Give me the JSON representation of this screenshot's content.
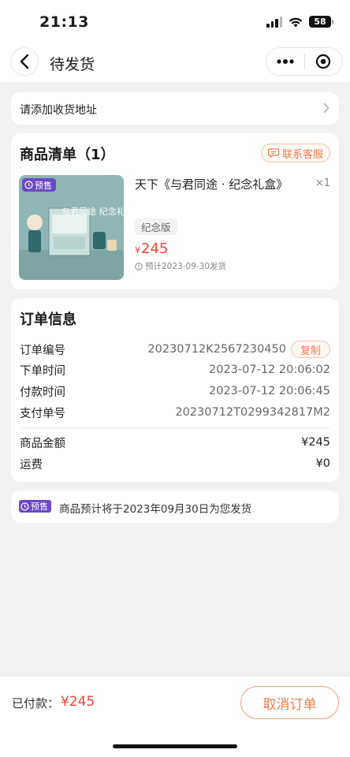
{
  "status_bar": {
    "time": "21:13",
    "battery": "58"
  },
  "nav": {
    "title": "待发货"
  },
  "address": {
    "placeholder_text": "请添加收货地址"
  },
  "goods": {
    "title": "商品清单（1）",
    "contact_label": "联系客服",
    "presale_badge": "预售",
    "product_name": "天下《与君同途 · 纪念礼盒》",
    "quantity": "×1",
    "variant": "纪念版",
    "price_symbol": "¥",
    "price": "245",
    "ship_estimate": "预计2023-09-30发货",
    "image_caption": "与君同途 纪念礼盒"
  },
  "order_info": {
    "title": "订单信息",
    "rows": [
      {
        "label": "订单编号",
        "value": "20230712K2567230450"
      },
      {
        "label": "下单时间",
        "value": "2023-07-12 20:06:02"
      },
      {
        "label": "付款时间",
        "value": "2023-07-12 20:06:45"
      },
      {
        "label": "支付单号",
        "value": "20230712T0299342817M2"
      }
    ],
    "copy_label": "复制",
    "amount_rows": [
      {
        "label": "商品金额",
        "value": "¥245"
      },
      {
        "label": "运费",
        "value": "¥0"
      }
    ]
  },
  "notice": {
    "badge": "预售",
    "text": "商品预计将于2023年09月30日为您发货"
  },
  "bottom": {
    "paid_label": "已付款：",
    "paid_amount": "¥245",
    "cancel_label": "取消订单"
  },
  "colors": {
    "accent": "#ea7f4d",
    "price": "#f0453a",
    "presale": "#6b49c4"
  }
}
